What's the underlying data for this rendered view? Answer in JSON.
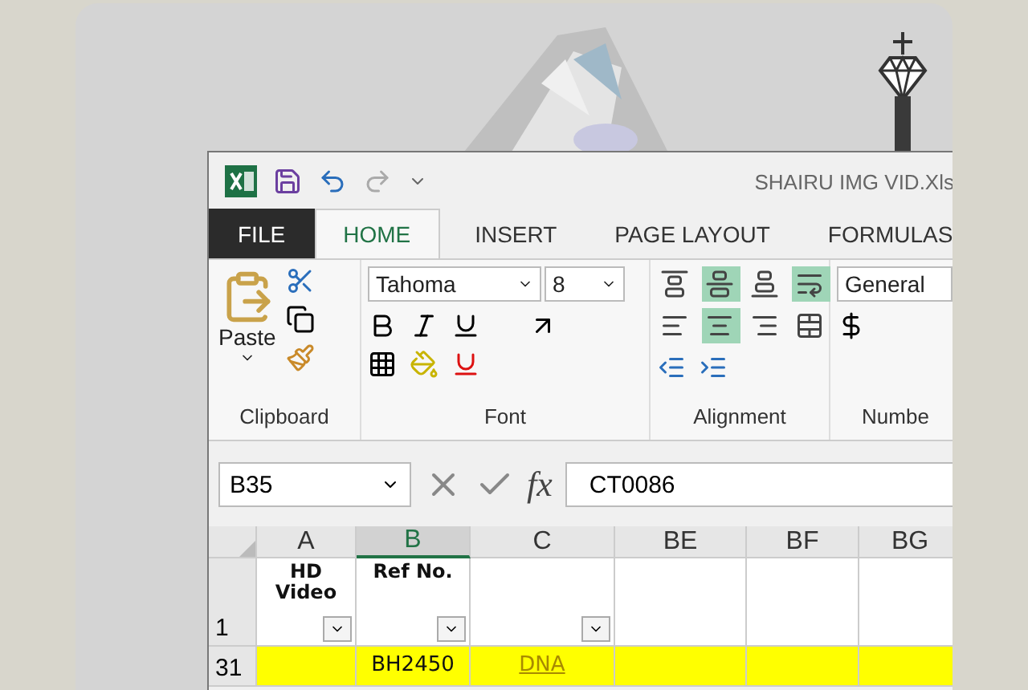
{
  "window": {
    "title": "SHAIRU IMG VID.Xls"
  },
  "tabs": [
    {
      "label": "FILE",
      "kind": "file",
      "selected": false
    },
    {
      "label": "HOME",
      "kind": "tab",
      "selected": true
    },
    {
      "label": "INSERT",
      "kind": "tab",
      "selected": false
    },
    {
      "label": "PAGE LAYOUT",
      "kind": "tab",
      "selected": false
    },
    {
      "label": "FORMULAS",
      "kind": "tab",
      "selected": false
    }
  ],
  "ribbon": {
    "paste_label": "Paste",
    "font_name": "Tahoma",
    "font_size": "8",
    "number_format": "General",
    "align_buttons": [
      {
        "kind": "top",
        "selected": false
      },
      {
        "kind": "middle",
        "selected": true
      },
      {
        "kind": "bottom",
        "selected": false
      },
      {
        "kind": "wrap",
        "selected": true
      },
      {
        "kind": "left",
        "selected": false
      },
      {
        "kind": "center",
        "selected": true
      },
      {
        "kind": "right",
        "selected": false
      },
      {
        "kind": "merge",
        "selected": false
      }
    ],
    "groups": [
      "Clipboard",
      "Font",
      "Alignment",
      "Numbe"
    ]
  },
  "formula_bar": {
    "name_box": "B35",
    "function_label": "fx",
    "value": "CT0086"
  },
  "columns": [
    {
      "label": "A",
      "selected": false
    },
    {
      "label": "B",
      "selected": true
    },
    {
      "label": "C",
      "selected": false
    },
    {
      "label": "BE",
      "selected": false
    },
    {
      "label": "BF",
      "selected": false
    },
    {
      "label": "BG",
      "selected": false
    }
  ],
  "rows": [
    {
      "number": "1",
      "kind": "header",
      "highlighted": false,
      "cells": [
        {
          "text": "HD Video",
          "filter": true
        },
        {
          "text": "Ref No.",
          "filter": true
        },
        {
          "filter": true
        },
        {},
        {},
        {}
      ]
    },
    {
      "number": "31",
      "kind": "data",
      "highlighted": true,
      "cells": [
        {},
        {
          "text": "BH2450"
        },
        {
          "text": "DNA",
          "link": true
        },
        {},
        {},
        {}
      ]
    }
  ]
}
